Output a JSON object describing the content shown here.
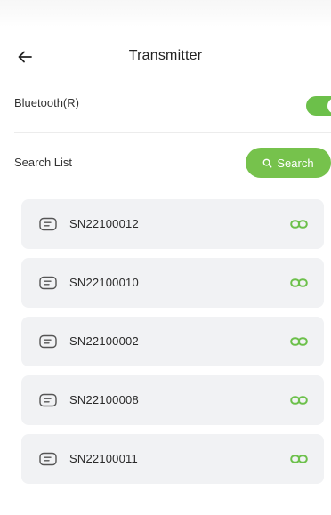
{
  "header": {
    "title": "Transmitter",
    "back_icon": "arrow-left-icon"
  },
  "bluetooth": {
    "label": "Bluetooth(R)",
    "enabled": true
  },
  "search": {
    "list_label": "Search List",
    "button_label": "Search",
    "button_icon": "search-icon"
  },
  "devices": [
    {
      "serial": "SN22100012",
      "icon": "device-card-icon",
      "status_icon": "link-icon"
    },
    {
      "serial": "SN22100010",
      "icon": "device-card-icon",
      "status_icon": "link-icon"
    },
    {
      "serial": "SN22100002",
      "icon": "device-card-icon",
      "status_icon": "link-icon"
    },
    {
      "serial": "SN22100008",
      "icon": "device-card-icon",
      "status_icon": "link-icon"
    },
    {
      "serial": "SN22100011",
      "icon": "device-card-icon",
      "status_icon": "link-icon"
    }
  ],
  "colors": {
    "accent_green": "#76c24c",
    "toggle_green": "#6cc04a",
    "list_item_bg": "#f1f2f4"
  }
}
